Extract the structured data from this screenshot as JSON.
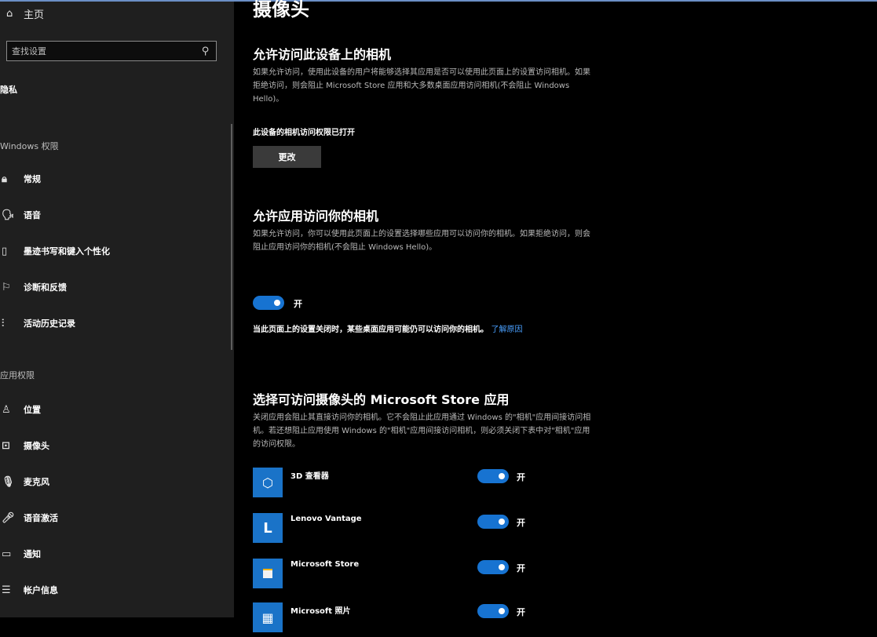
{
  "sidebar": {
    "home_label": "主页",
    "search_placeholder": "查找设置",
    "section_title": "隐私",
    "windows_group": "Windows 权限",
    "windows_items": [
      "常规",
      "语音",
      "墨迹书写和键入个性化",
      "诊断和反馈",
      "活动历史记录"
    ],
    "apps_group": "应用权限",
    "apps_items": [
      "位置",
      "摄像头",
      "麦克风",
      "语音激活",
      "通知",
      "帐户信息"
    ]
  },
  "main": {
    "title": "摄像头",
    "device_section": {
      "heading": "允许访问此设备上的相机",
      "description": "如果允许访问，使用此设备的用户将能够选择其应用是否可以使用此页面上的设置访问相机。如果拒绝访问，则会阻止 Microsoft Store 应用和大多数桌面应用访问相机(不会阻止 Windows Hello)。",
      "status": "此设备的相机访问权限已打开",
      "change_button": "更改"
    },
    "app_section": {
      "heading": "允许应用访问你的相机",
      "description": "如果允许访问，你可以使用此页面上的设置选择哪些应用可以访问你的相机。如果拒绝访问，则会阻止应用访问你的相机(不会阻止 Windows Hello)。",
      "toggle_label": "开",
      "note": "当此页面上的设置关闭时，某些桌面应用可能仍可以访问你的相机。",
      "note_link": "了解原因"
    },
    "store_section": {
      "heading": "选择可访问摄像头的 Microsoft Store 应用",
      "description": "关闭应用会阻止其直接访问你的相机。它不会阻止此应用通过 Windows 的\"相机\"应用间接访问相机。若还想阻止应用使用 Windows 的\"相机\"应用间接访问相机，则必须关闭下表中对\"相机\"应用的访问权限。",
      "apps": [
        {
          "name": "3D 查看器",
          "toggle": "开",
          "icon": "cube-icon"
        },
        {
          "name": "Lenovo Vantage",
          "toggle": "开",
          "icon": "L"
        },
        {
          "name": "Microsoft Store",
          "toggle": "开",
          "icon": "store-icon"
        },
        {
          "name": "Microsoft 照片",
          "toggle": "开",
          "icon": "photos-icon"
        }
      ]
    }
  },
  "colors": {
    "toggle_on": "#1773d1",
    "link": "#4aa0ff",
    "sidebar_bg": "#1f1f1f",
    "app_icon_bg": "#1a73c8"
  }
}
